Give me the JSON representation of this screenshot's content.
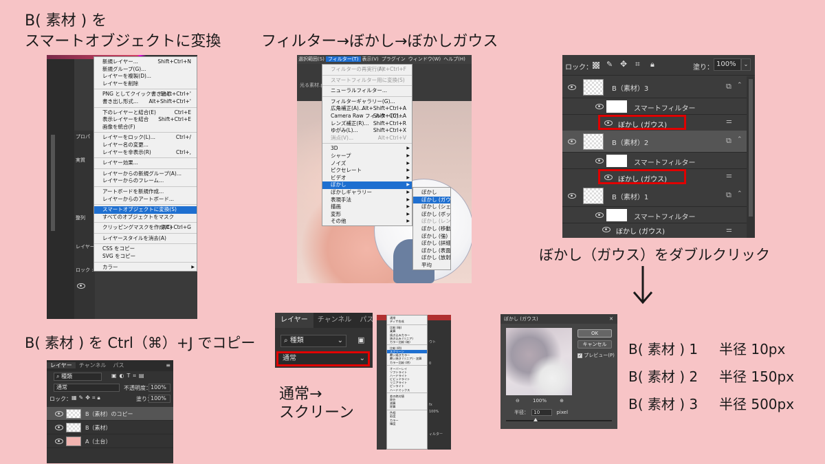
{
  "captions": {
    "step1_line1": "B( 素材 ) を",
    "step1_line2": "スマートオブジェクトに変換",
    "step2": "フィルター→ぼかし→ぼかしガウス",
    "step3": "ぼかし（ガウス）をダブルクリック",
    "step4": "B( 素材 ) を Ctrl（⌘）+J でコピー",
    "step5_line1": "通常→",
    "step5_line2": "スクリーン",
    "radius": [
      {
        "label": "B( 素材 ) 1",
        "value": "半径 10px"
      },
      {
        "label": "B( 素材 ) 2",
        "value": "半径 150px"
      },
      {
        "label": "B( 素材 ) 3",
        "value": "半径 500px"
      }
    ]
  },
  "layer_menu": {
    "left_panel": [
      "プロパ",
      "実質",
      "整列",
      "レイヤー",
      "ロック :"
    ],
    "items": [
      {
        "label": "新規レイヤー...",
        "sc": "Shift+Ctrl+N"
      },
      {
        "label": "新規グループ(G)..."
      },
      {
        "label": "レイヤーを複製(D)..."
      },
      {
        "label": "レイヤーを削除"
      },
      {
        "sep": true
      },
      {
        "label": "PNG としてクイック書き出し",
        "sc": "Shift+Ctrl+'"
      },
      {
        "label": "書き出し形式...",
        "sc": "Alt+Shift+Ctrl+'"
      },
      {
        "sep": true
      },
      {
        "label": "下のレイヤーと結合(E)",
        "sc": "Ctrl+E"
      },
      {
        "label": "表示レイヤーを結合",
        "sc": "Shift+Ctrl+E"
      },
      {
        "label": "画像を統合(F)"
      },
      {
        "sep": true
      },
      {
        "label": "レイヤーをロック(L)...",
        "sc": "Ctrl+/"
      },
      {
        "label": "レイヤー名の変更..."
      },
      {
        "label": "レイヤーを非表示(R)",
        "sc": "Ctrl+,"
      },
      {
        "sep": true
      },
      {
        "label": "レイヤー効果..."
      },
      {
        "sep": true
      },
      {
        "label": "レイヤーからの新規グループ(A)..."
      },
      {
        "label": "レイヤーからのフレーム..."
      },
      {
        "sep": true
      },
      {
        "label": "アートボードを新規作成..."
      },
      {
        "label": "レイヤーからのアートボード..."
      },
      {
        "sep": true
      },
      {
        "label": "スマートオブジェクトに変換(S)",
        "hl": true
      },
      {
        "label": "すべてのオブジェクトをマスク"
      },
      {
        "sep": true
      },
      {
        "label": "クリッピングマスクを作成(C)",
        "sc": "Alt+Ctrl+G"
      },
      {
        "sep": true
      },
      {
        "label": "レイヤースタイルを消去(A)"
      },
      {
        "sep": true
      },
      {
        "label": "CSS をコピー"
      },
      {
        "label": "SVG をコピー"
      },
      {
        "sep": true
      },
      {
        "label": "カラー",
        "arrow": true
      }
    ]
  },
  "filter_menu": {
    "menubar": [
      "選択範囲(S)",
      "フィルター(T)",
      "表示(V)",
      "プラグイン",
      "ウィンドウ(W)",
      "ヘルプ(H)"
    ],
    "doc_tab": "光る素材.ps",
    "items": [
      {
        "label": "フィルターの再実行(F)",
        "sc": "Alt+Ctrl+F",
        "dis": true
      },
      {
        "sep": true
      },
      {
        "label": "スマートフィルター用に変換(S)",
        "dis": true
      },
      {
        "sep": true
      },
      {
        "label": "ニューラルフィルター..."
      },
      {
        "sep": true
      },
      {
        "label": "フィルターギャラリー(G)..."
      },
      {
        "label": "広角補正(A)...",
        "sc": "Alt+Shift+Ctrl+A"
      },
      {
        "label": "Camera Raw フィルター(C)...",
        "sc": "Shift+Ctrl+A"
      },
      {
        "label": "レンズ補正(R)...",
        "sc": "Shift+Ctrl+R"
      },
      {
        "label": "ゆがみ(L)...",
        "sc": "Shift+Ctrl+X"
      },
      {
        "label": "消点(V)...",
        "sc": "Alt+Ctrl+V",
        "dis": true
      },
      {
        "sep": true
      },
      {
        "label": "3D",
        "arrow": true
      },
      {
        "label": "シャープ",
        "arrow": true
      },
      {
        "label": "ノイズ",
        "arrow": true
      },
      {
        "label": "ピクセレート",
        "arrow": true
      },
      {
        "label": "ビデオ",
        "arrow": true
      },
      {
        "label": "ぼかし",
        "arrow": true,
        "hl": true
      },
      {
        "label": "ぼかしギャラリー",
        "arrow": true
      },
      {
        "label": "表現手法",
        "arrow": true
      },
      {
        "label": "描画",
        "arrow": true
      },
      {
        "label": "変形",
        "arrow": true
      },
      {
        "label": "その他",
        "arrow": true
      }
    ],
    "submenu": [
      {
        "label": "ぼかし"
      },
      {
        "label": "ぼかし (ガウス)...",
        "hl": true
      },
      {
        "label": "ぼかし (シェイプ)..."
      },
      {
        "label": "ぼかし (ボックス)..."
      },
      {
        "label": "ぼかし (レンズ)...",
        "dis": true
      },
      {
        "label": "ぼかし (移動)..."
      },
      {
        "label": "ぼかし (強)"
      },
      {
        "label": "ぼかし (詳細)..."
      },
      {
        "label": "ぼかし (表面)..."
      },
      {
        "label": "ぼかし (放射状)..."
      },
      {
        "label": "平均"
      }
    ]
  },
  "layers_panel": {
    "lock_label": "ロック：",
    "fill_label": "塗り：",
    "fill_value": "100%",
    "groups": [
      {
        "name": "B（素材）3",
        "smart": "スマートフィルター",
        "filter": "ぼかし (ガウス)",
        "red": true
      },
      {
        "name": "B（素材）2",
        "smart": "スマートフィルター",
        "filter": "ぼかし (ガウス)",
        "red": true
      },
      {
        "name": "B（素材）1",
        "smart": "スマートフィルター",
        "filter": "ぼかし (ガウス)",
        "red": false
      }
    ]
  },
  "copy_panel": {
    "tabs": [
      "レイヤー",
      "チャンネル",
      "パス"
    ],
    "kind": "種類",
    "blend": "通常",
    "opacity_label": "不透明度：",
    "opacity": "100%",
    "lock": "ロック：",
    "fill_label": "塗り：",
    "fill": "100%",
    "layers": [
      "B（素材）のコピー",
      "B（素材）",
      "A（土台）"
    ]
  },
  "blend_panel": {
    "tabs": [
      "レイヤー",
      "チャンネル",
      "パス"
    ],
    "kind": "種類",
    "blend": "通常"
  },
  "blend_list": {
    "items": [
      "通常",
      "ディザ合成",
      "-",
      "比較 (暗)",
      "乗算",
      "焼き込みカラー",
      "焼き込み (リニア)",
      "カラー比較 (暗)",
      "-",
      "比較 (明)",
      "スクリーン",
      "覆い焼きカラー",
      "覆い焼き (リニア) - 加算",
      "カラー比較 (明)",
      "-",
      "オーバーレイ",
      "ソフトライト",
      "ハードライト",
      "ビビッドライト",
      "リニアライト",
      "ピンライト",
      "ハードミックス",
      "-",
      "差の絶対値",
      "除外",
      "減算",
      "除算",
      "-",
      "色相",
      "彩度",
      "カラー",
      "輝度"
    ],
    "highlight": "スクリーン",
    "side_texts": [
      "ウト",
      "0",
      "fx",
      "100%",
      "ィルター"
    ]
  },
  "gauss_dialog": {
    "title": "ぼかし (ガウス)",
    "ok": "OK",
    "cancel": "キャンセル",
    "preview": "プレビュー(P)",
    "zoom": "100%",
    "radius_label": "半径：",
    "radius_value": "10",
    "unit": "pixel"
  }
}
